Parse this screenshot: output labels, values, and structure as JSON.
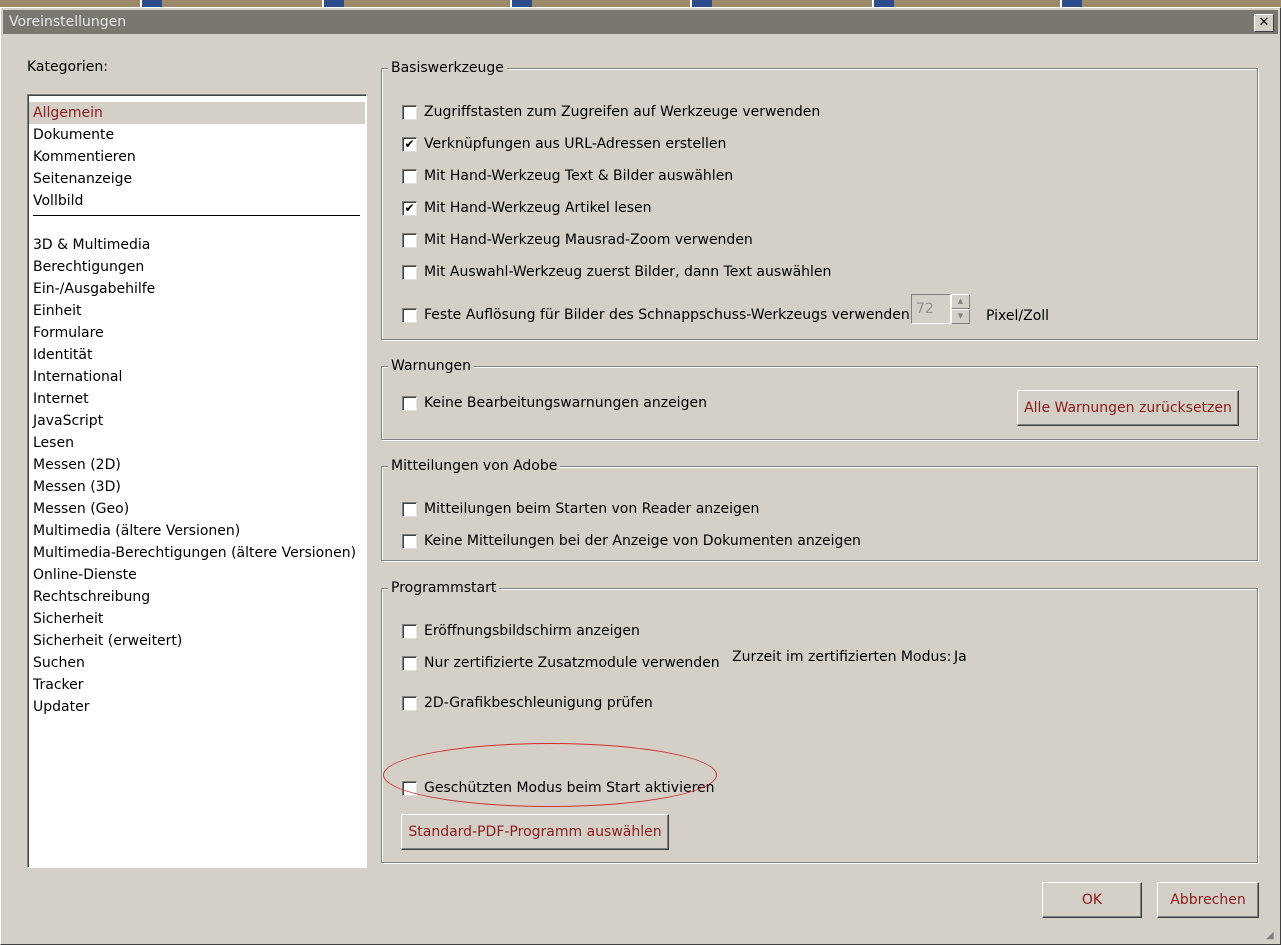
{
  "window": {
    "title": "Voreinstellungen",
    "close_glyph": "✕"
  },
  "categories": {
    "label": "Kategorien:",
    "primary": [
      "Allgemein",
      "Dokumente",
      "Kommentieren",
      "Seitenanzeige",
      "Vollbild"
    ],
    "secondary": [
      "3D & Multimedia",
      "Berechtigungen",
      "Ein-/Ausgabehilfe",
      "Einheit",
      "Formulare",
      "Identität",
      "International",
      "Internet",
      "JavaScript",
      "Lesen",
      "Messen (2D)",
      "Messen (3D)",
      "Messen (Geo)",
      "Multimedia (ältere Versionen)",
      "Multimedia-Berechtigungen (ältere Versionen)",
      "Online-Dienste",
      "Rechtschreibung",
      "Sicherheit",
      "Sicherheit (erweitert)",
      "Suchen",
      "Tracker",
      "Updater"
    ],
    "selected": "Allgemein"
  },
  "basiswerkzeuge": {
    "title": "Basiswerkzeuge",
    "options": [
      {
        "label": "Zugriffstasten zum Zugreifen auf Werkzeuge verwenden",
        "checked": false
      },
      {
        "label": "Verknüpfungen aus URL-Adressen erstellen",
        "checked": true
      },
      {
        "label": "Mit Hand-Werkzeug Text & Bilder auswählen",
        "checked": false
      },
      {
        "label": "Mit Hand-Werkzeug Artikel lesen",
        "checked": true
      },
      {
        "label": "Mit Hand-Werkzeug Mausrad-Zoom verwenden",
        "checked": false
      },
      {
        "label": "Mit Auswahl-Werkzeug zuerst Bilder, dann Text auswählen",
        "checked": false
      },
      {
        "label": "Feste Auflösung für Bilder des Schnappschuss-Werkzeugs verwenden:",
        "checked": false
      }
    ],
    "resolution_value": "72",
    "resolution_unit": "Pixel/Zoll"
  },
  "warnungen": {
    "title": "Warnungen",
    "option": {
      "label": "Keine Bearbeitungswarnungen anzeigen",
      "checked": false
    },
    "reset_button": "Alle Warnungen zurücksetzen"
  },
  "mitteilungen": {
    "title": "Mitteilungen von Adobe",
    "options": [
      {
        "label": "Mitteilungen beim Starten von Reader anzeigen",
        "checked": false
      },
      {
        "label": "Keine Mitteilungen bei der Anzeige von Dokumenten anzeigen",
        "checked": false
      }
    ]
  },
  "programmstart": {
    "title": "Programmstart",
    "options": [
      {
        "label": "Eröffnungsbildschirm anzeigen",
        "checked": false
      },
      {
        "label": "Nur zertifizierte Zusatzmodule verwenden",
        "checked": false
      },
      {
        "label": "2D-Grafikbeschleunigung prüfen",
        "checked": false
      },
      {
        "label": "Geschützten Modus beim Start aktivieren",
        "checked": false
      }
    ],
    "certified_mode_label": "Zurzeit im zertifizierten Modus:",
    "certified_mode_value": "Ja",
    "default_pdf_button": "Standard-PDF-Programm auswählen"
  },
  "footer": {
    "ok": "OK",
    "cancel": "Abbrechen"
  },
  "colors": {
    "accent_text": "#8b1a1a",
    "dialog_bg": "#d4d0c8",
    "highlight_ellipse": "#d03030"
  }
}
